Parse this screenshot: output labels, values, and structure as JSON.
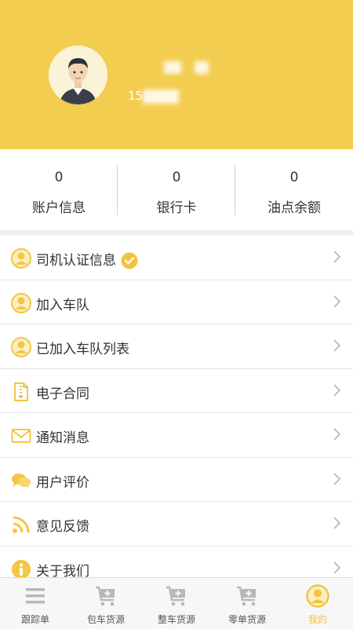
{
  "profile": {
    "phone_prefix": "15"
  },
  "stats": [
    {
      "value": "0",
      "label": "账户信息"
    },
    {
      "value": "0",
      "label": "银行卡"
    },
    {
      "value": "0",
      "label": "油点余额"
    }
  ],
  "menu": [
    {
      "label": "司机认证信息",
      "icon": "user-circle-icon",
      "verified": true
    },
    {
      "label": "加入车队",
      "icon": "user-circle-icon"
    },
    {
      "label": "已加入车队列表",
      "icon": "user-circle-icon"
    },
    {
      "label": "电子合同",
      "icon": "document-icon"
    },
    {
      "label": "通知消息",
      "icon": "mail-icon"
    },
    {
      "label": "用户评价",
      "icon": "chat-bubbles-icon"
    },
    {
      "label": "意见反馈",
      "icon": "rss-icon"
    },
    {
      "label": "关于我们",
      "icon": "info-icon"
    }
  ],
  "tabs": [
    {
      "label": "跟踪单",
      "icon": "list-icon",
      "active": false
    },
    {
      "label": "包车货源",
      "icon": "cart-plus-icon",
      "active": false
    },
    {
      "label": "整车货源",
      "icon": "cart-plus-icon",
      "active": false
    },
    {
      "label": "零单货源",
      "icon": "cart-plus-icon",
      "active": false
    },
    {
      "label": "我的",
      "icon": "user-circle-icon",
      "active": true
    }
  ],
  "colors": {
    "accent": "#f3cd4f",
    "active_tab": "#f2c33c",
    "inactive_icon": "#b8b8b8"
  }
}
